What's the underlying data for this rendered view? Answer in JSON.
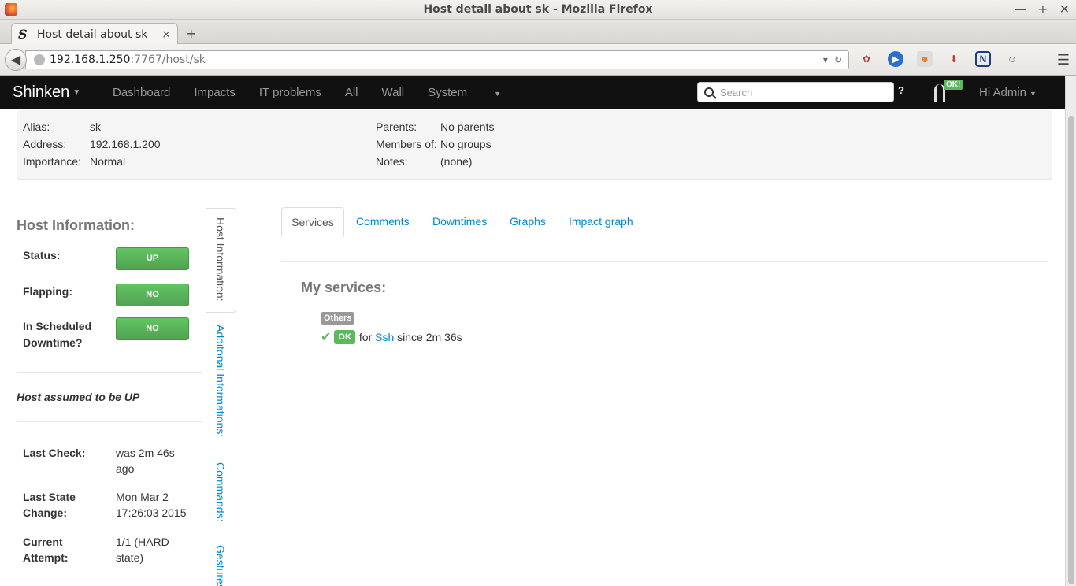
{
  "window": {
    "title": "Host detail about sk - Mozilla Firefox",
    "controls": [
      "—",
      "+",
      "✕"
    ]
  },
  "browser": {
    "tab_title": "Host detail about sk",
    "tab_favicon": "S",
    "tab_close": "×",
    "new_tab": "+",
    "url_host": "192.168.1.250",
    "url_rest": ":7767/host/sk"
  },
  "app": {
    "brand": "Shinken",
    "menu": [
      "Dashboard",
      "Impacts",
      "IT problems",
      "All",
      "Wall",
      "System"
    ],
    "search_placeholder": "Search",
    "help": "?",
    "ok_badge": "OK!",
    "user": "Hi Admin"
  },
  "host_summary": {
    "alias_label": "Alias:",
    "alias": "sk",
    "address_label": "Address:",
    "address": "192.168.1.200",
    "importance_label": "Importance:",
    "importance": "Normal",
    "parents_label": "Parents:",
    "parents": "No parents",
    "members_label": "Members of:",
    "members": "No groups",
    "notes_label": "Notes:",
    "notes": "(none)"
  },
  "host_info": {
    "title": "Host Information:",
    "status_label": "Status:",
    "status": "UP",
    "flapping_label": "Flapping:",
    "flapping": "NO",
    "downtime_label": "In Scheduled Downtime?",
    "downtime": "NO",
    "assumed": "Host assumed to be UP",
    "last_check_label": "Last Check:",
    "last_check": "was 2m 46s ago",
    "last_state_label": "Last State Change:",
    "last_state": "Mon Mar 2 17:26:03 2015",
    "attempt_label": "Current Attempt:",
    "attempt": "1/1 (HARD state)"
  },
  "side_tabs": [
    "Host Information:",
    "Additonal Informations:",
    "Commands:",
    "Gestures:"
  ],
  "main_tabs": [
    "Services",
    "Comments",
    "Downtimes",
    "Graphs",
    "Impact graph"
  ],
  "services": {
    "title": "My services:",
    "group": "Others",
    "state": "OK",
    "prefix": "for",
    "name": "Ssh",
    "since": "since 2m 36s"
  }
}
